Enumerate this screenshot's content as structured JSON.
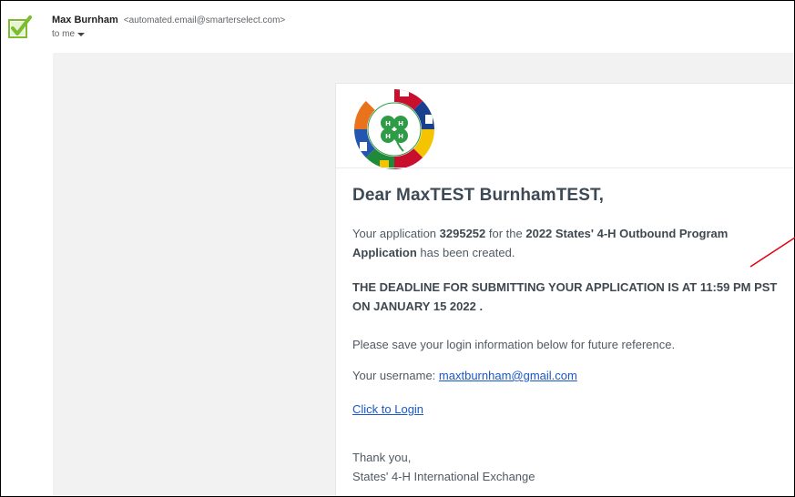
{
  "header": {
    "sender_name": "Max Burnham",
    "sender_email": "<automated.email@smarterselect.com>",
    "to_label": "to me"
  },
  "email": {
    "greeting": "Dear MaxTEST BurnhamTEST,",
    "para1": {
      "prefix": "Your application ",
      "app_id": "3295252",
      "middle": " for the ",
      "program": "2022 States' 4-H Outbound Program Application",
      "suffix": " has been created."
    },
    "deadline": "THE DEADLINE FOR SUBMITTING YOUR APPLICATION IS AT 11:59 PM PST ON JANUARY 15 2022 .",
    "save_info": "Please save your login information below for future reference.",
    "username_label": "Your username: ",
    "username": "maxtburnham@gmail.com",
    "login_link": "Click to Login",
    "signoff": "Thank you,",
    "signature": "States' 4-H International Exchange"
  },
  "colors": {
    "check_green": "#7cbd2f",
    "link_blue": "#1a57c7",
    "clover_green": "#2e9b47",
    "annotation_red": "#e0000f"
  },
  "icons": {
    "avatar": "green-checkmark-icon",
    "caret": "caret-down-icon",
    "logo": "states-4h-international-logo"
  }
}
